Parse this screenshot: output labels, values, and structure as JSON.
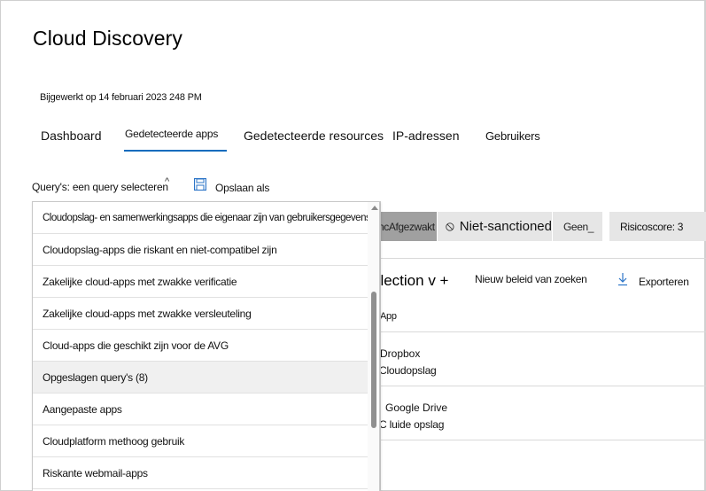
{
  "page": {
    "title": "Cloud Discovery",
    "updated": "Bijgewerkt op 14 februari 2023 248 PM"
  },
  "tabs": [
    {
      "label": "Dashboard",
      "active": false
    },
    {
      "label": "Gedetecteerde apps",
      "active": true
    },
    {
      "label": "Gedetecteerde resources",
      "active": false
    },
    {
      "label": "IP-adressen",
      "active": false
    },
    {
      "label": "Gebruikers",
      "active": false
    }
  ],
  "toolbar": {
    "query_label": "Query's: een query selecteren",
    "save_as_label": "Opslaan als"
  },
  "filters": {
    "sanctioned": "ncAfgezwakt",
    "unsanctioned": "Niet-sanctioned",
    "none": "Geen_",
    "risk_score": "Risicoscore: 3"
  },
  "actions": {
    "selection": "election v +",
    "new_policy": "Nieuw beleid van zoeken",
    "export": "Exporteren"
  },
  "table": {
    "column_header": "App",
    "rows": [
      {
        "name": "Dropbox",
        "category": "Cloudopslag"
      },
      {
        "name": "Google Drive",
        "category": "C luide opslag"
      }
    ]
  },
  "dropdown": {
    "items": [
      "Cloudopslag- en samenwerkingsapps die eigenaar zijn van gebruikersgegevens",
      "Cloudopslag-apps die riskant en niet-compatibel zijn",
      "Zakelijke cloud-apps met zwakke verificatie",
      "Zakelijke cloud-apps met zwakke versleuteling",
      "Cloud-apps die geschikt zijn voor de AVG",
      "Opgeslagen query's (8)",
      "Aangepaste apps",
      "Cloudplatform methoog gebruik",
      "Riskante webmail-apps"
    ],
    "hovered_index": 5
  },
  "colors": {
    "accent": "#0f6cbd",
    "chip_sanctioned_bg": "#a0a0a0",
    "chip_bg": "#e6e6e6"
  }
}
